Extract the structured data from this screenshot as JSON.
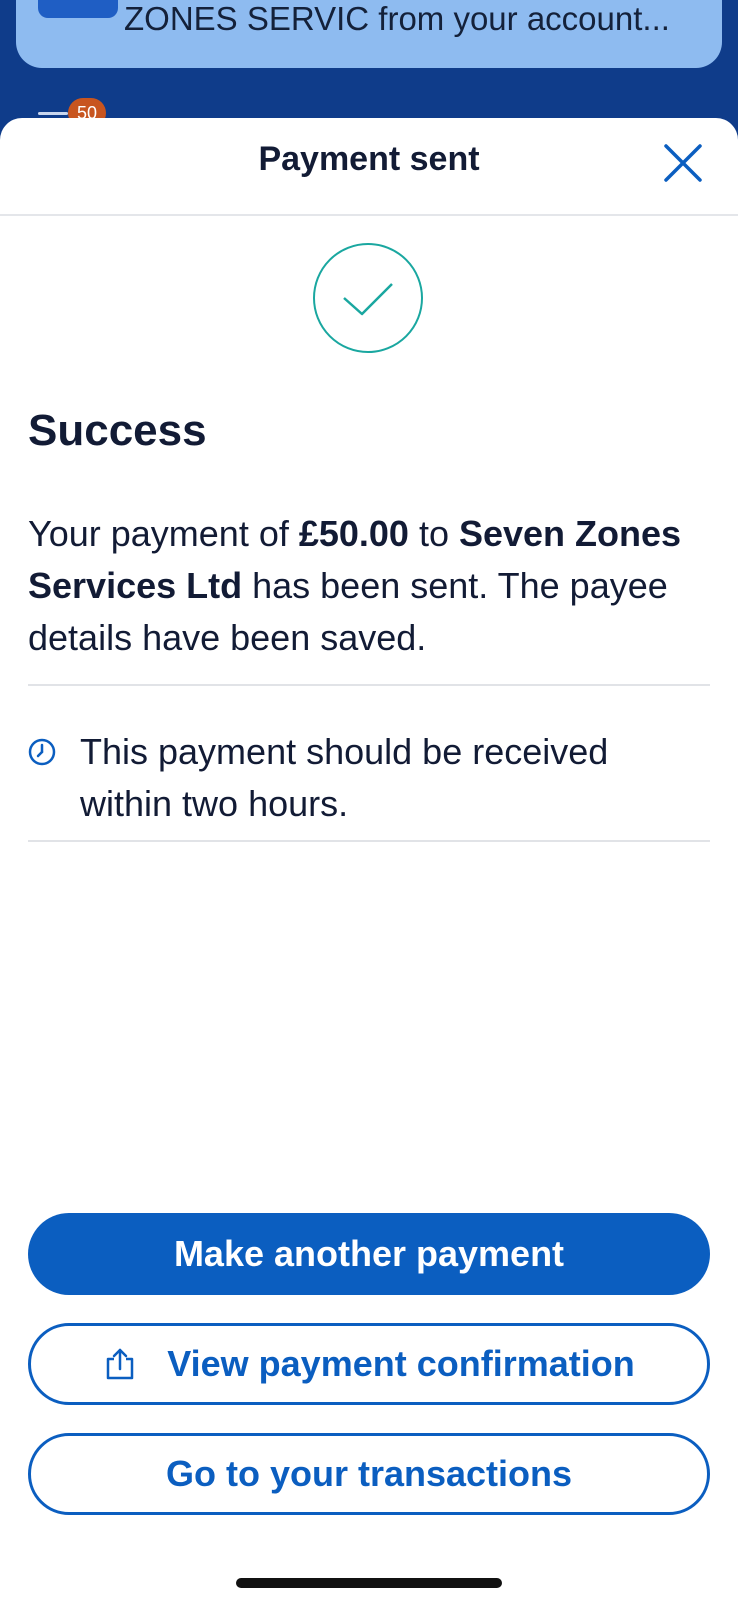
{
  "notification": {
    "text": "ZONES SERVIC from your account...",
    "app_icon": "bank-app-icon"
  },
  "background": {
    "badge_count": "50",
    "menu_icon": "menu-icon"
  },
  "sheet": {
    "title": "Payment sent",
    "close_icon": "close-icon",
    "status_icon": "checkmark-circle-icon",
    "heading": "Success",
    "message": {
      "prefix": "Your payment of ",
      "amount": "£50.00",
      "middle": " to ",
      "payee": "Seven Zones Services Ltd",
      "suffix": " has been sent. The payee details have been saved."
    },
    "info_icon": "clock-icon",
    "info_text": "This payment should be received within two hours."
  },
  "actions": {
    "primary_label": "Make another payment",
    "confirmation_label": "View payment confirmation",
    "confirmation_icon": "share-icon",
    "transactions_label": "Go to your transactions"
  },
  "colors": {
    "brand_blue": "#0b5ec0",
    "navy_text": "#121b35",
    "success_teal": "#1aa7a0",
    "notification_bg": "#8ebbf0"
  }
}
